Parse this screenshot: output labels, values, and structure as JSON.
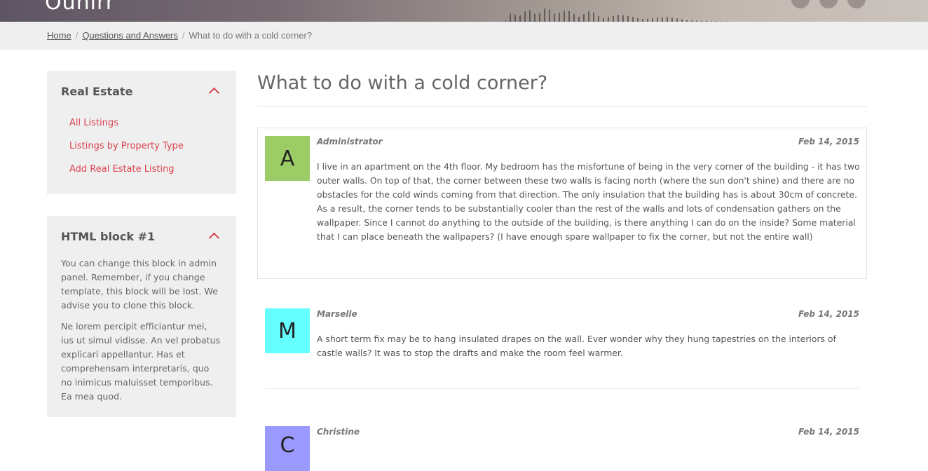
{
  "header": {
    "logo_text": "Ounirr"
  },
  "breadcrumb": {
    "home": "Home",
    "section": "Questions and Answers",
    "current": "What to do with a cold corner?",
    "separator": "/"
  },
  "sidebar": {
    "real_estate": {
      "title": "Real Estate",
      "links": [
        "All Listings",
        "Listings by Property Type",
        "Add Real Estate Listing"
      ]
    },
    "html_block": {
      "title": "HTML block #1",
      "paragraphs": [
        "You can change this block in admin panel. Remember, if you change template, this block will be lost. We advise you to clone this block.",
        "Ne lorem percipit efficiantur mei, ius ut simul vidisse. An vel probatus explicari appellantur. Has et comprehensam interpretaris, quo no inimicus maluisset temporibus. Ea mea quod."
      ]
    }
  },
  "main": {
    "title": "What to do with a cold corner?",
    "posts": [
      {
        "initial": "A",
        "author": "Administrator",
        "date": "Feb 14, 2015",
        "avatar_color": "#9ccc65",
        "text": "I live in an apartment on the 4th floor. My bedroom has the misfortune of being in the very corner of the building - it has two outer walls. On top of that, the corner between these two walls is facing north (where the sun don't shine) and there are no obstacles for the cold winds coming from that direction. The only insulation that the building has is about 30cm of concrete. As a result, the corner tends to be substantially cooler than the rest of the walls and lots of condensation gathers on the wallpaper. Since I cannot do anything to the outside of the building, is there anything I can do on the inside? Some material that I can place beneath the wallpapers? (I have enough spare wallpaper to fix the corner, but not the entire wall)"
      },
      {
        "initial": "M",
        "author": "Marselle",
        "date": "Feb 14, 2015",
        "avatar_color": "#66ffff",
        "text": "A short term fix may be to hang insulated drapes on the wall. Ever wonder why they hung tapestries on the interiors of castle walls? It was to stop the drafts and make the room feel warmer."
      },
      {
        "initial": "C",
        "author": "Christine",
        "date": "Feb 14, 2015",
        "avatar_color": "#9999ff",
        "text": ""
      }
    ]
  },
  "colors": {
    "accent": "#d9434e",
    "panel_bg": "#efefef"
  }
}
